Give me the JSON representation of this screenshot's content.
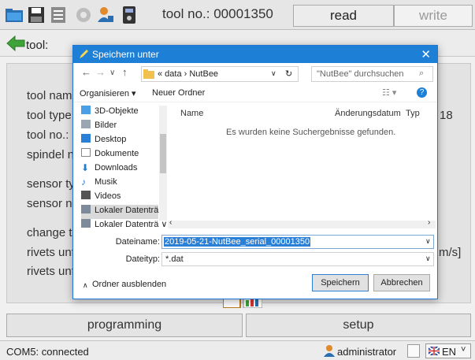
{
  "toolbar": {
    "tool_no": "tool no.: 00001350",
    "read": "read",
    "write": "write"
  },
  "tool_row": {
    "label": "tool:"
  },
  "labels": {
    "tool_name": "tool name",
    "tool_type": "tool type:",
    "tool_no": "tool no.:",
    "spindel": "spindel no",
    "sensor_type": "sensor typ",
    "sensor_no": "sensor no.",
    "change": "change th",
    "rivets_until_1": "rivets until",
    "rivets_until_2": "rivets until",
    "right_18": "18",
    "right_ms": "m/s]"
  },
  "dialog": {
    "title": "Speichern unter",
    "breadcrumb": "«  data  ›  NutBee",
    "search_placeholder": "\"NutBee\" durchsuchen",
    "organize": "Organisieren ▾",
    "new_folder": "Neuer Ordner",
    "tree": [
      "3D-Objekte",
      "Bilder",
      "Desktop",
      "Dokumente",
      "Downloads",
      "Musik",
      "Videos",
      "Lokaler Datenträ",
      "Lokaler Datenträ ∨"
    ],
    "col_name": "Name",
    "col_date": "Änderungsdatum",
    "col_type": "Typ",
    "empty_message": "Es wurden keine Suchergebnisse gefunden.",
    "filename_label": "Dateiname:",
    "filename_value": "2019-05-21-NutBee_serial_00001350",
    "filetype_label": "Dateityp:",
    "filetype_value": "*.dat",
    "hide_folders": "Ordner ausblenden",
    "save": "Speichern",
    "cancel": "Abbrechen"
  },
  "bottom": {
    "programming": "programming",
    "setup": "setup"
  },
  "status": {
    "connection": "COM5: connected",
    "user": "administrator",
    "language": "EN"
  }
}
